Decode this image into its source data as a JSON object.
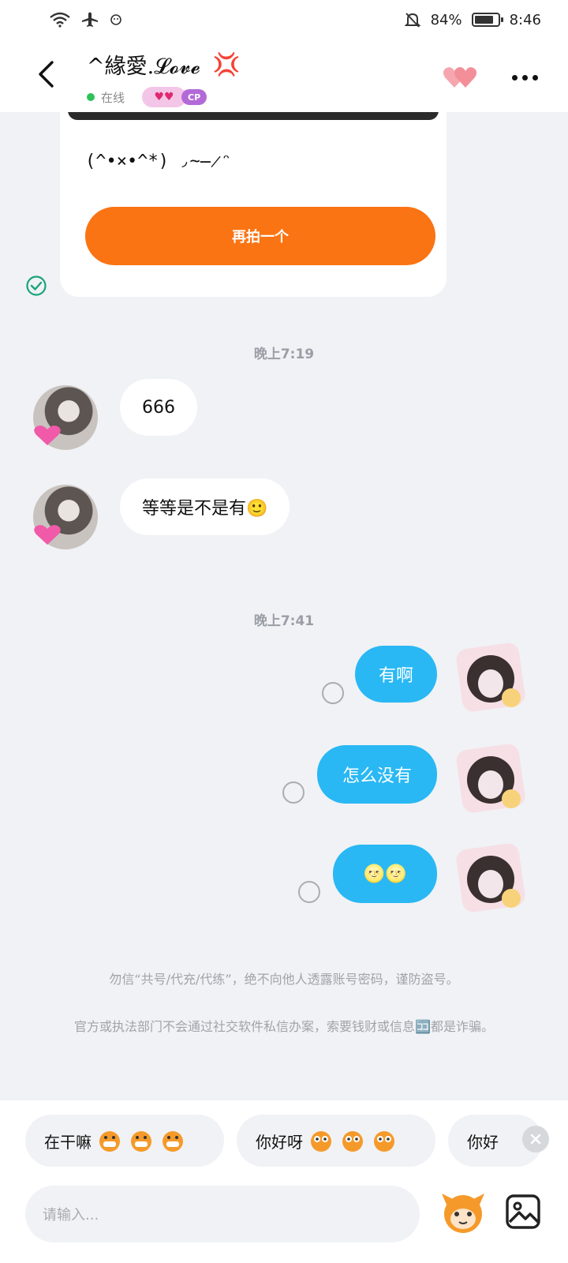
{
  "status_bar": {
    "battery": "84%",
    "time": "8:46",
    "battery_level": 0.84
  },
  "header": {
    "title": "^緣愛.𝓛𝓸𝓿𝓮",
    "anger_emoji": "💢",
    "status": "在线",
    "cp_label": "CP"
  },
  "card": {
    "emoticon": "(^•×•^*) ◞̴̶̷ᵔ",
    "retake_label": "再拍一个"
  },
  "messages": {
    "time1": "晚上7:19",
    "in1": "666",
    "in2": "等等是不是有🙂",
    "time2": "晚上7:41",
    "out1": "有啊",
    "out2": "怎么没有",
    "out3": "🌝🌝"
  },
  "notice": {
    "line1": "勿信“共号/代充/代练”，绝不向他人透露账号密码，谨防盗号。",
    "line2": "官方或执法部门不会通过社交软件私信办案，索要钱财或信息🈁都是诈骗。"
  },
  "quick_replies": [
    "在干嘛",
    "你好呀",
    "你好"
  ],
  "input": {
    "placeholder": "请输入..."
  },
  "colors": {
    "accent_orange": "#fa7414",
    "bubble_blue": "#29b8f4",
    "online_green": "#2ec259"
  }
}
